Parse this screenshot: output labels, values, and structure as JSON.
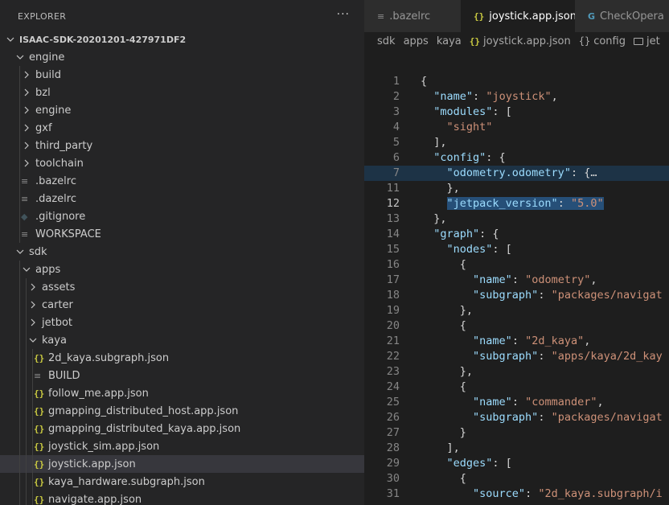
{
  "explorer": {
    "title": "EXPLORER",
    "more": "···",
    "items": [
      {
        "label": "ISAAC-SDK-20201201-427971DF2",
        "depth": 0,
        "type": "root",
        "open": true
      },
      {
        "label": "engine",
        "depth": 1,
        "type": "folder",
        "open": true
      },
      {
        "label": "build",
        "depth": 2,
        "type": "folder",
        "open": false
      },
      {
        "label": "bzl",
        "depth": 2,
        "type": "folder",
        "open": false
      },
      {
        "label": "engine",
        "depth": 2,
        "type": "folder",
        "open": false
      },
      {
        "label": "gxf",
        "depth": 2,
        "type": "folder",
        "open": false
      },
      {
        "label": "third_party",
        "depth": 2,
        "type": "folder",
        "open": false
      },
      {
        "label": "toolchain",
        "depth": 2,
        "type": "folder",
        "open": false
      },
      {
        "label": ".bazelrc",
        "depth": 2,
        "type": "lines"
      },
      {
        "label": ".dazelrc",
        "depth": 2,
        "type": "lines"
      },
      {
        "label": ".gitignore",
        "depth": 2,
        "type": "git"
      },
      {
        "label": "WORKSPACE",
        "depth": 2,
        "type": "lines"
      },
      {
        "label": "sdk",
        "depth": 1,
        "type": "folder",
        "open": true
      },
      {
        "label": "apps",
        "depth": 2,
        "type": "folder",
        "open": true
      },
      {
        "label": "assets",
        "depth": 3,
        "type": "folder",
        "open": false
      },
      {
        "label": "carter",
        "depth": 3,
        "type": "folder",
        "open": false
      },
      {
        "label": "jetbot",
        "depth": 3,
        "type": "folder",
        "open": false
      },
      {
        "label": "kaya",
        "depth": 3,
        "type": "folder",
        "open": true
      },
      {
        "label": "2d_kaya.subgraph.json",
        "depth": 4,
        "type": "json"
      },
      {
        "label": "BUILD",
        "depth": 4,
        "type": "lines"
      },
      {
        "label": "follow_me.app.json",
        "depth": 4,
        "type": "json"
      },
      {
        "label": "gmapping_distributed_host.app.json",
        "depth": 4,
        "type": "json"
      },
      {
        "label": "gmapping_distributed_kaya.app.json",
        "depth": 4,
        "type": "json"
      },
      {
        "label": "joystick_sim.app.json",
        "depth": 4,
        "type": "json"
      },
      {
        "label": "joystick.app.json",
        "depth": 4,
        "type": "json",
        "selected": true
      },
      {
        "label": "kaya_hardware.subgraph.json",
        "depth": 4,
        "type": "json"
      },
      {
        "label": "navigate.app.json",
        "depth": 4,
        "type": "json"
      }
    ]
  },
  "tabs": [
    {
      "label": ".bazelrc",
      "icon": "lines-icon",
      "active": false
    },
    {
      "label": "joystick.app.json",
      "icon": "json-icon",
      "active": true,
      "close": "×"
    },
    {
      "label": "CheckOpera",
      "icon": "cpp-icon",
      "active": false
    }
  ],
  "breadcrumb": [
    "sdk",
    "apps",
    "kaya",
    "joystick.app.json",
    "config",
    "jet"
  ],
  "icons": {
    "json": "{}",
    "lines": "≡",
    "git": "◆",
    "cpp": "G"
  },
  "code": [
    {
      "n": "1",
      "t": [
        [
          "p",
          "{"
        ]
      ]
    },
    {
      "n": "2",
      "t": [
        [
          "p",
          "  "
        ],
        [
          "k",
          "\"name\""
        ],
        [
          "p",
          ": "
        ],
        [
          "s",
          "\"joystick\""
        ],
        [
          "p",
          ","
        ]
      ]
    },
    {
      "n": "3",
      "t": [
        [
          "p",
          "  "
        ],
        [
          "k",
          "\"modules\""
        ],
        [
          "p",
          ": ["
        ]
      ]
    },
    {
      "n": "4",
      "t": [
        [
          "p",
          "    "
        ],
        [
          "s",
          "\"sight\""
        ]
      ]
    },
    {
      "n": "5",
      "t": [
        [
          "p",
          "  ],"
        ]
      ]
    },
    {
      "n": "6",
      "t": [
        [
          "p",
          "  "
        ],
        [
          "k",
          "\"config\""
        ],
        [
          "p",
          ": {"
        ]
      ]
    },
    {
      "n": "7",
      "t": [
        [
          "p",
          "    "
        ],
        [
          "k",
          "\"odometry.odometry\""
        ],
        [
          "p",
          ": {…"
        ]
      ],
      "fold": true,
      "hl": true
    },
    {
      "n": "11",
      "t": [
        [
          "p",
          "    },"
        ]
      ]
    },
    {
      "n": "12",
      "t": [
        [
          "p",
          "    "
        ],
        [
          "k",
          "\"jetpack_version\""
        ],
        [
          "p",
          ": "
        ],
        [
          "s",
          "\"5.0\""
        ]
      ],
      "cur": true,
      "sel": true
    },
    {
      "n": "13",
      "t": [
        [
          "p",
          "  },"
        ]
      ]
    },
    {
      "n": "14",
      "t": [
        [
          "p",
          "  "
        ],
        [
          "k",
          "\"graph\""
        ],
        [
          "p",
          ": {"
        ]
      ]
    },
    {
      "n": "15",
      "t": [
        [
          "p",
          "    "
        ],
        [
          "k",
          "\"nodes\""
        ],
        [
          "p",
          ": ["
        ]
      ]
    },
    {
      "n": "16",
      "t": [
        [
          "p",
          "      {"
        ]
      ]
    },
    {
      "n": "17",
      "t": [
        [
          "p",
          "        "
        ],
        [
          "k",
          "\"name\""
        ],
        [
          "p",
          ": "
        ],
        [
          "s",
          "\"odometry\""
        ],
        [
          "p",
          ","
        ]
      ]
    },
    {
      "n": "18",
      "t": [
        [
          "p",
          "        "
        ],
        [
          "k",
          "\"subgraph\""
        ],
        [
          "p",
          ": "
        ],
        [
          "s",
          "\"packages/navigat"
        ]
      ]
    },
    {
      "n": "19",
      "t": [
        [
          "p",
          "      },"
        ]
      ]
    },
    {
      "n": "20",
      "t": [
        [
          "p",
          "      {"
        ]
      ]
    },
    {
      "n": "21",
      "t": [
        [
          "p",
          "        "
        ],
        [
          "k",
          "\"name\""
        ],
        [
          "p",
          ": "
        ],
        [
          "s",
          "\"2d_kaya\""
        ],
        [
          "p",
          ","
        ]
      ]
    },
    {
      "n": "22",
      "t": [
        [
          "p",
          "        "
        ],
        [
          "k",
          "\"subgraph\""
        ],
        [
          "p",
          ": "
        ],
        [
          "s",
          "\"apps/kaya/2d_kay"
        ]
      ]
    },
    {
      "n": "23",
      "t": [
        [
          "p",
          "      },"
        ]
      ]
    },
    {
      "n": "24",
      "t": [
        [
          "p",
          "      {"
        ]
      ]
    },
    {
      "n": "25",
      "t": [
        [
          "p",
          "        "
        ],
        [
          "k",
          "\"name\""
        ],
        [
          "p",
          ": "
        ],
        [
          "s",
          "\"commander\""
        ],
        [
          "p",
          ","
        ]
      ]
    },
    {
      "n": "26",
      "t": [
        [
          "p",
          "        "
        ],
        [
          "k",
          "\"subgraph\""
        ],
        [
          "p",
          ": "
        ],
        [
          "s",
          "\"packages/navigat"
        ]
      ]
    },
    {
      "n": "27",
      "t": [
        [
          "p",
          "      }"
        ]
      ]
    },
    {
      "n": "28",
      "t": [
        [
          "p",
          "    ],"
        ]
      ]
    },
    {
      "n": "29",
      "t": [
        [
          "p",
          "    "
        ],
        [
          "k",
          "\"edges\""
        ],
        [
          "p",
          ": ["
        ]
      ]
    },
    {
      "n": "30",
      "t": [
        [
          "p",
          "      {"
        ]
      ]
    },
    {
      "n": "31",
      "t": [
        [
          "p",
          "        "
        ],
        [
          "k",
          "\"source\""
        ],
        [
          "p",
          ": "
        ],
        [
          "s",
          "\"2d_kaya.subgraph/i"
        ]
      ]
    }
  ],
  "colors": {
    "accent": "#007acc",
    "string": "#ce9178",
    "key": "#9cdcfe",
    "json_icon": "#cbcb41"
  }
}
